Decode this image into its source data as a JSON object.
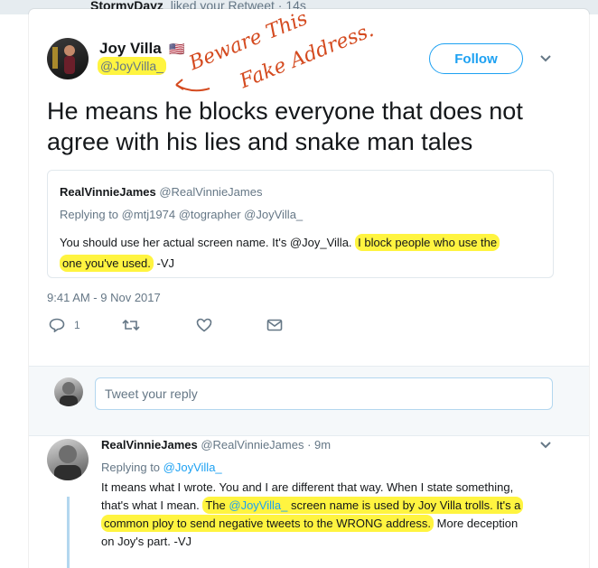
{
  "background": {
    "actor": "StormyDayz",
    "action": "liked your Retweet",
    "time": "14s"
  },
  "tweet": {
    "name": "Joy Villa",
    "flag": "🇺🇸",
    "handle": "@JoyVilla_",
    "follow_label": "Follow",
    "text": "He means he blocks everyone that does not agree with his lies and snake man tales",
    "timestamp": "9:41 AM - 9 Nov 2017",
    "reply_count": "1"
  },
  "annotation": {
    "line1": "Beware This",
    "line2": "Fake Address."
  },
  "quote": {
    "name": "RealVinnieJames",
    "handle": "@RealVinnieJames",
    "replying_to": "Replying to @mtj1974 @tographer @JoyVilla_",
    "body_plain": "You should use her actual screen name. It's @Joy_Villa.",
    "body_highlight_1": "I block people who use the",
    "body_highlight_2": "one you've used.",
    "body_end": "-VJ"
  },
  "reply_box": {
    "placeholder": "Tweet your reply"
  },
  "reply": {
    "name": "RealVinnieJames",
    "meta": "@RealVinnieJames · 9m",
    "replying_label": "Replying to",
    "replying_handle": "@JoyVilla_",
    "p1": "It means what I wrote. You and I are different that way. When I state something,",
    "p2a": "that's what I mean.",
    "p2b": "The",
    "p2c": "@JoyVilla_",
    "p2d": "screen name is used by Joy Villa trolls. It's a",
    "p3": "common ploy to send negative tweets to the WRONG address.",
    "p3b": "More deception",
    "p4": "on Joy's part. -VJ"
  },
  "colors": {
    "accent": "#1da1f2",
    "highlight": "#fff000",
    "ink": "#d44a1f"
  }
}
